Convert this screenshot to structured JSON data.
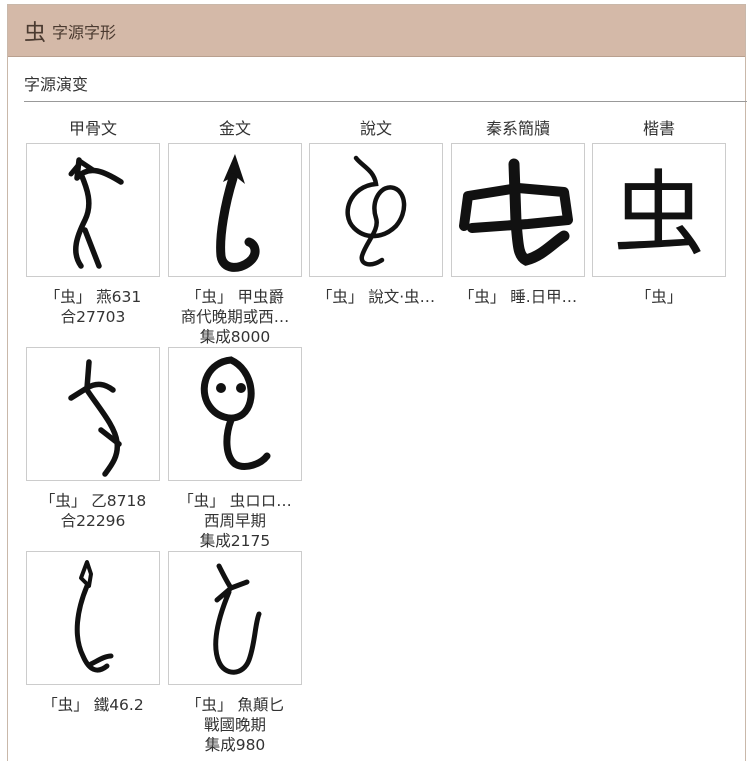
{
  "header": {
    "char": "虫",
    "title": "字源字形"
  },
  "section": {
    "title": "字源演变"
  },
  "columns": [
    "甲骨文",
    "金文",
    "說文",
    "秦系簡牘",
    "楷書"
  ],
  "cards": [
    {
      "name": "oracle-1",
      "lines": [
        "「虫」 燕631",
        "合27703"
      ]
    },
    {
      "name": "bronze-1",
      "lines": [
        "「虫」 甲虫爵",
        "商代晚期或西…",
        "集成8000"
      ]
    },
    {
      "name": "shuowen-1",
      "lines": [
        "「虫」 說文·虫…"
      ]
    },
    {
      "name": "qin-1",
      "lines": [
        "「虫」 睡.日甲…"
      ]
    },
    {
      "name": "kaishu-1",
      "lines": [
        "「虫」"
      ],
      "glyph": "虫"
    },
    {
      "name": "oracle-2",
      "lines": [
        "「虫」 乙8718",
        "合22296"
      ]
    },
    {
      "name": "bronze-2",
      "lines": [
        "「虫」 虫ロロ…",
        "西周早期",
        "集成2175"
      ]
    },
    {
      "name": "oracle-3",
      "lines": [
        "「虫」 鐵46.2"
      ]
    },
    {
      "name": "bronze-3",
      "lines": [
        "「虫」 魚顛匕",
        "戰國晚期",
        "集成980"
      ]
    }
  ]
}
